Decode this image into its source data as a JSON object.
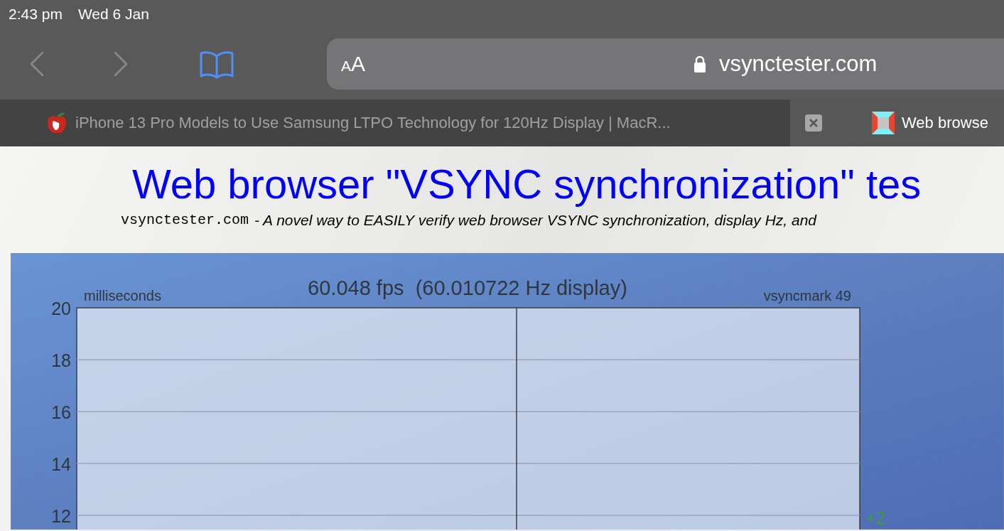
{
  "status_bar": {
    "time": "2:43 pm",
    "date": "Wed 6 Jan"
  },
  "toolbar": {
    "back_disabled": true,
    "forward_disabled": true,
    "reader_button": "AA",
    "url": "vsynctester.com"
  },
  "tabs": [
    {
      "title": "iPhone 13 Pro Models to Use Samsung LTPO Technology for 120Hz Display | MacR...",
      "selected": false
    },
    {
      "title": "Web browse",
      "selected": true
    }
  ],
  "page": {
    "heading": "Web browser \"VSYNC synchronization\" tes",
    "site": "vsynctester.com",
    "tagline": "- A novel way to EASILY verify web browser VSYNC synchronization, display Hz, and",
    "chart": {
      "title": "60.048 fps  (60.010722 Hz display)",
      "unit": "milliseconds",
      "mark": "vsyncmark 49",
      "y_labels": [
        "20",
        "18",
        "16",
        "14",
        "12"
      ],
      "offset": "+2"
    }
  }
}
